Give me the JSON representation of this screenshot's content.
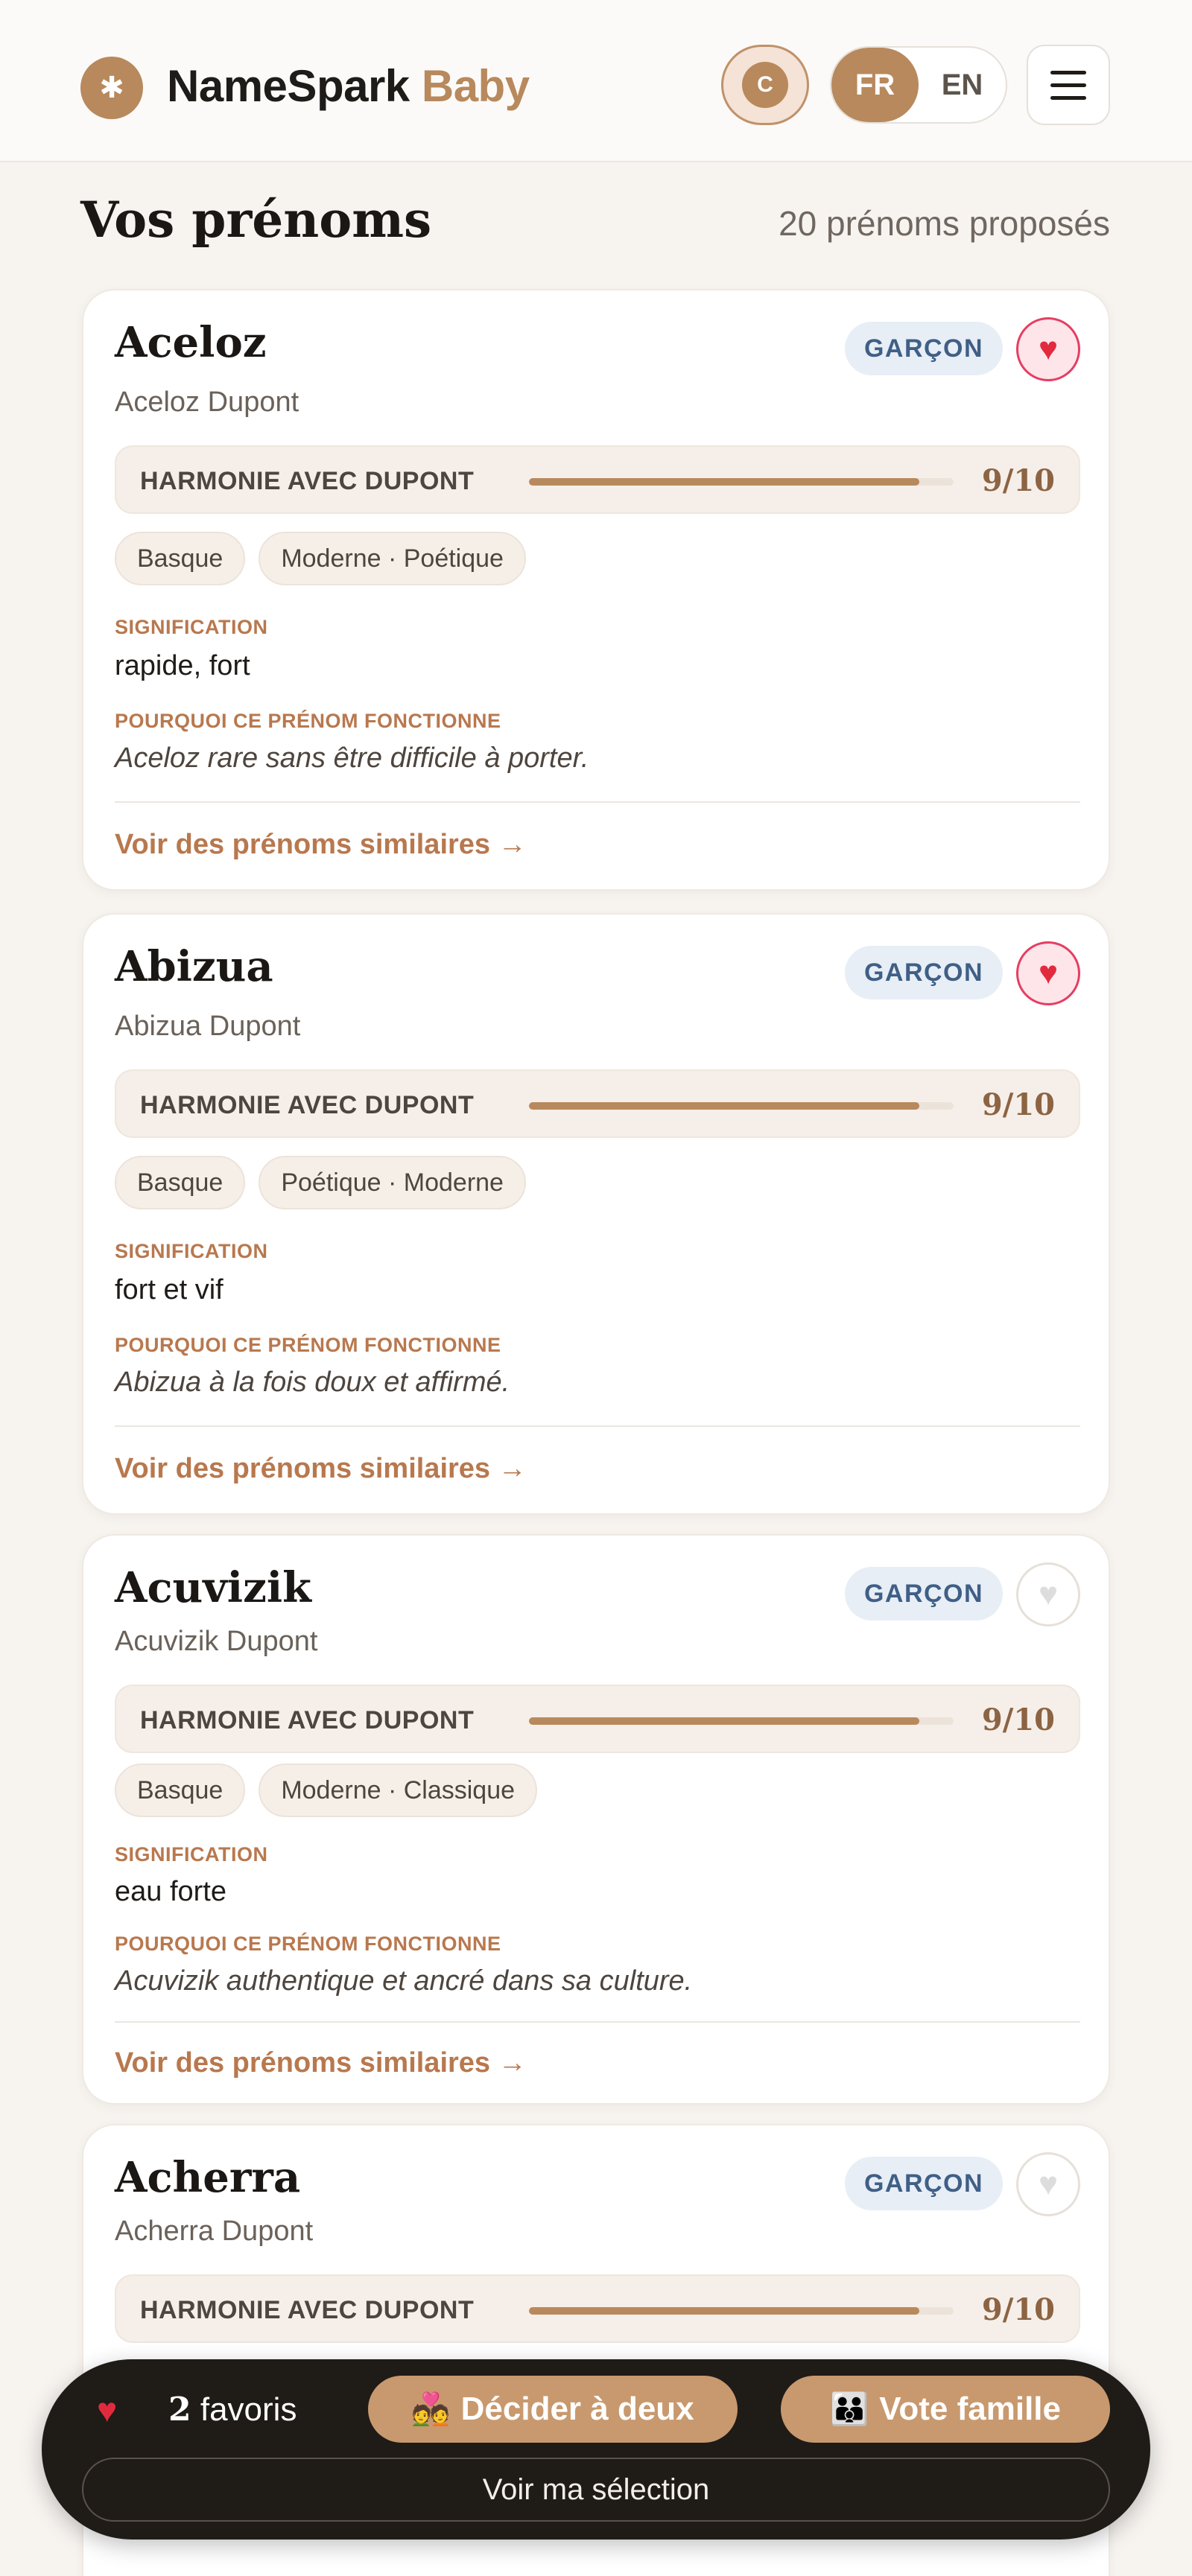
{
  "header": {
    "logo_icon": "spark-icon",
    "logo_name": "NameSpark",
    "logo_accent": "Baby",
    "avatar_initial": "C",
    "lang": [
      "FR",
      "EN"
    ],
    "lang_active": "FR"
  },
  "main": {
    "title": "Vos prénoms",
    "count_label": "20 prénoms proposés",
    "cards": [
      {
        "name": "Aceloz",
        "full_name": "Aceloz Dupont",
        "gender": "GARÇON",
        "favorite": true,
        "harmony_label": "HARMONIE AVEC DUPONT",
        "harmony_score": "9/10",
        "harmony_fraction": 0.92,
        "tags": [
          "Basque",
          "Moderne · Poétique"
        ],
        "meaning_label": "SIGNIFICATION",
        "meaning": "rapide, fort",
        "why_label": "POURQUOI CE PRÉNOM FONCTIONNE",
        "why": "Aceloz rare sans être difficile à porter.",
        "similar": "Voir des prénoms similaires →"
      },
      {
        "name": "Abizua",
        "full_name": "Abizua Dupont",
        "gender": "GARÇON",
        "favorite": true,
        "harmony_label": "HARMONIE AVEC DUPONT",
        "harmony_score": "9/10",
        "harmony_fraction": 0.92,
        "tags": [
          "Basque",
          "Poétique · Moderne"
        ],
        "meaning_label": "SIGNIFICATION",
        "meaning": "fort et vif",
        "why_label": "POURQUOI CE PRÉNOM FONCTIONNE",
        "why": "Abizua à la fois doux et affirmé.",
        "similar": "Voir des prénoms similaires →"
      },
      {
        "name": "Acuvizik",
        "full_name": "Acuvizik Dupont",
        "gender": "GARÇON",
        "favorite": false,
        "harmony_label": "HARMONIE AVEC DUPONT",
        "harmony_score": "9/10",
        "harmony_fraction": 0.92,
        "tags": [
          "Basque",
          "Moderne · Classique"
        ],
        "meaning_label": "SIGNIFICATION",
        "meaning": "eau forte",
        "why_label": "POURQUOI CE PRÉNOM FONCTIONNE",
        "why": "Acuvizik authentique et ancré dans sa culture.",
        "similar": "Voir des prénoms similaires →"
      },
      {
        "name": "Acherra",
        "full_name": "Acherra Dupont",
        "gender": "GARÇON",
        "favorite": false,
        "harmony_label": "HARMONIE AVEC DUPONT",
        "harmony_score": "9/10",
        "harmony_fraction": 0.92
      }
    ]
  },
  "bottom_bar": {
    "heart_icon": "heart-icon",
    "fav_count": "2",
    "fav_label": "favoris",
    "decide_emoji": "💑",
    "decide_label": "Décider à deux",
    "vote_emoji": "👪",
    "vote_label": "Vote famille",
    "selection_label": "Voir ma sélection"
  },
  "colors": {
    "accent": "#b8895d",
    "accent_text": "#b8784e",
    "background": "#f7f4f0",
    "favorite": "#e22a3f",
    "badge_text": "#3f5f86",
    "bar_dark": "#1f1b17"
  }
}
